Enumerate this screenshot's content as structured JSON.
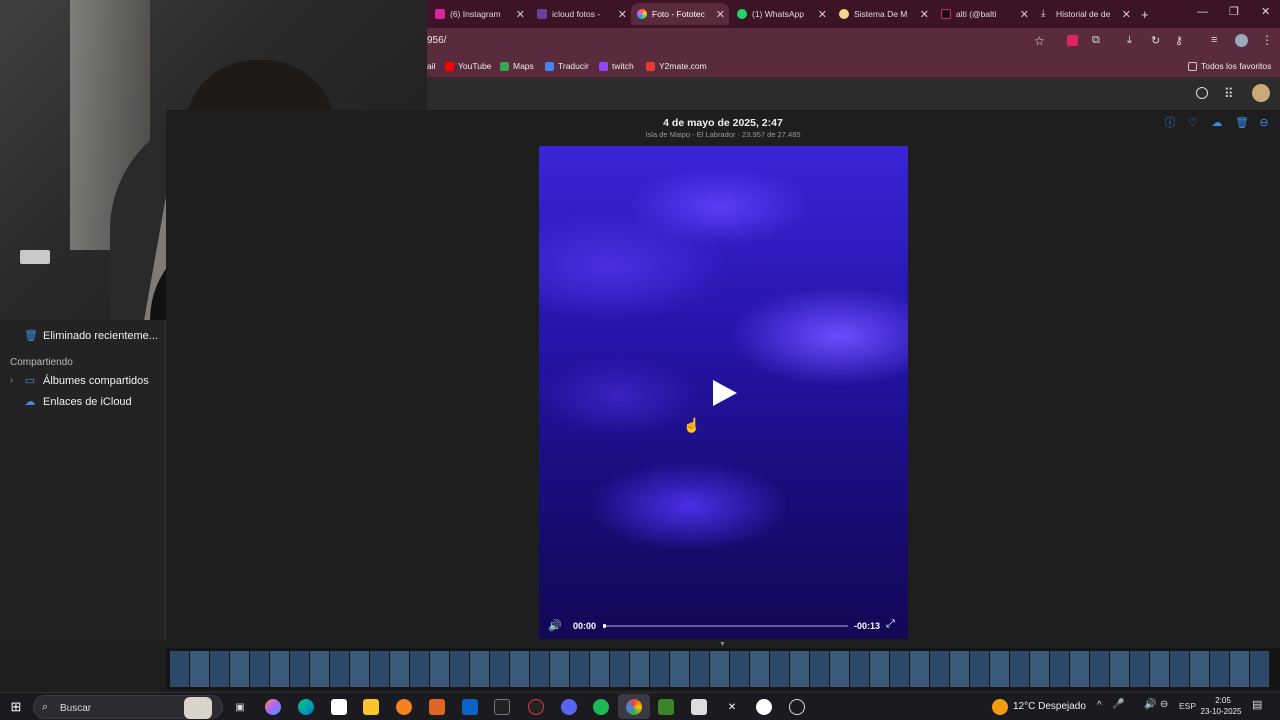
{
  "tabs": [
    {
      "label": "(6) Instagram",
      "color": "#d6249f",
      "active": false
    },
    {
      "label": "icloud fotos - ",
      "color": "#6b3fa0",
      "active": false
    },
    {
      "label": "Foto - Fototec",
      "color": "#e0e0e0",
      "active": true
    },
    {
      "label": "(1) WhatsApp",
      "color": "#25d366",
      "active": false
    },
    {
      "label": "Sistema De M",
      "color": "#f4d58d",
      "active": false
    },
    {
      "label": "alti (@balti",
      "color": "#e0245e",
      "active": false
    },
    {
      "label": "Historial de de",
      "color": "#dddddd",
      "active": false
    }
  ],
  "address": {
    "url": "956/"
  },
  "bookmarks": [
    {
      "label": "ail"
    },
    {
      "label": "YouTube"
    },
    {
      "label": "Maps"
    },
    {
      "label": "Traducir"
    },
    {
      "label": "twitch"
    },
    {
      "label": "Y2mate.com"
    }
  ],
  "bookmarks_right": "Todos los favoritos",
  "photo": {
    "title": "4 de mayo de 2025, 2:47",
    "subtitle": "Isla de Maipo - El Labrador · 23.957 de 27.485"
  },
  "sidebar": {
    "deleted_label": "Eliminado recienteme...",
    "section_label": "Compartiendo",
    "shared_albums_label": "Álbumes compartidos",
    "icloud_links_label": "Enlaces de iCloud"
  },
  "video": {
    "current_time": "00:00",
    "remaining_time": "-00:13"
  },
  "taskbar": {
    "search_placeholder": "Buscar",
    "weather": "12°C  Despejado",
    "lang": "ESP",
    "time": "2:05",
    "date": "23-10-2025"
  },
  "colors": {
    "accent": "#3a8ee8",
    "chrome_tab_bg": "#3c1426",
    "chrome_toolbar": "#5a2a3d"
  }
}
